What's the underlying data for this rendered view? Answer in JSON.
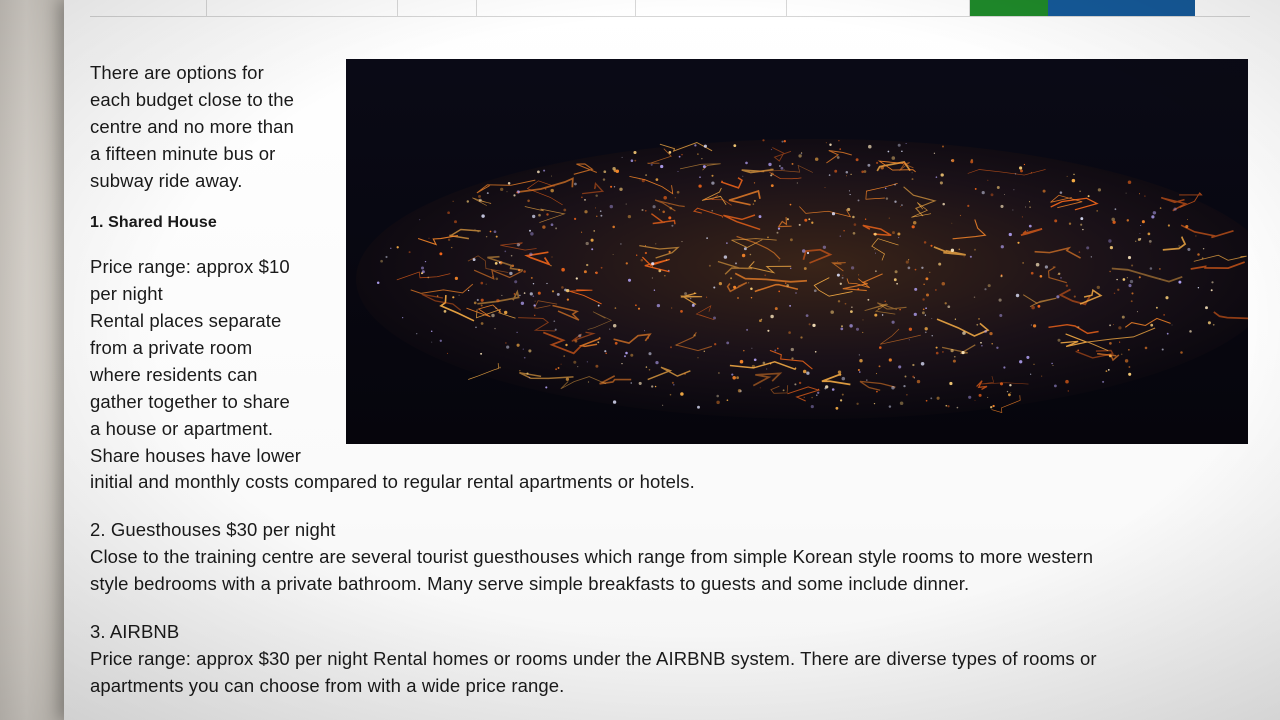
{
  "article": {
    "intro_lines": [
      "There are options for",
      "each budget close to the",
      "centre and no more than",
      "a fifteen minute bus or",
      "subway ride away."
    ],
    "section1": {
      "heading": "1. Shared House",
      "lines": [
        "Price range: approx $10",
        "per night",
        "Rental places separate",
        "from a private room",
        "where residents can",
        "gather together to share",
        "a house or apartment.",
        "Share houses have lower"
      ],
      "tail": "initial and monthly costs compared to regular rental apartments or hotels."
    },
    "section2": {
      "heading": "2. Guesthouses $30 per night",
      "lines": [
        "Close to the training centre are several tourist guesthouses which range from simple Korean style rooms to more western",
        "style bedrooms with a private bathroom. Many serve simple breakfasts to guests and some include dinner."
      ]
    },
    "section3": {
      "heading": "3. AIRBNB",
      "lines": [
        "Price range: approx $30 per night Rental homes or rooms under the AIRBNB system. There are diverse types of rooms or",
        "apartments you can choose from with a wide price range."
      ]
    }
  },
  "colors": {
    "nav_green": "#1f8a2a",
    "nav_blue": "#155a9a",
    "text": "#1a1a1a"
  }
}
